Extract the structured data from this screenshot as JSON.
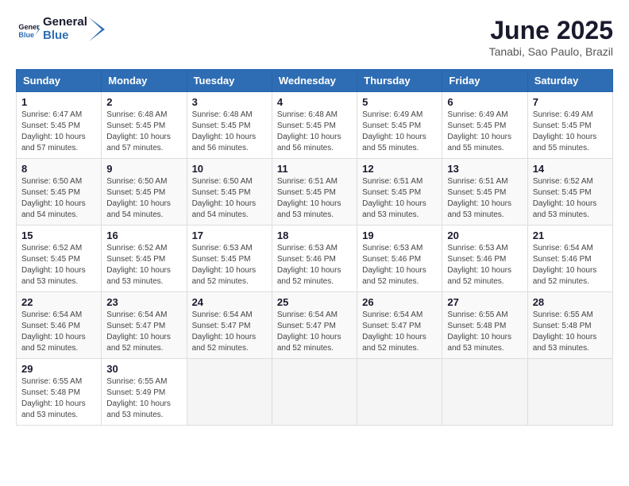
{
  "header": {
    "logo_text_general": "General",
    "logo_text_blue": "Blue",
    "month_title": "June 2025",
    "location": "Tanabi, Sao Paulo, Brazil"
  },
  "days_of_week": [
    "Sunday",
    "Monday",
    "Tuesday",
    "Wednesday",
    "Thursday",
    "Friday",
    "Saturday"
  ],
  "weeks": [
    [
      {
        "day": "1",
        "info": "Sunrise: 6:47 AM\nSunset: 5:45 PM\nDaylight: 10 hours\nand 57 minutes."
      },
      {
        "day": "2",
        "info": "Sunrise: 6:48 AM\nSunset: 5:45 PM\nDaylight: 10 hours\nand 57 minutes."
      },
      {
        "day": "3",
        "info": "Sunrise: 6:48 AM\nSunset: 5:45 PM\nDaylight: 10 hours\nand 56 minutes."
      },
      {
        "day": "4",
        "info": "Sunrise: 6:48 AM\nSunset: 5:45 PM\nDaylight: 10 hours\nand 56 minutes."
      },
      {
        "day": "5",
        "info": "Sunrise: 6:49 AM\nSunset: 5:45 PM\nDaylight: 10 hours\nand 55 minutes."
      },
      {
        "day": "6",
        "info": "Sunrise: 6:49 AM\nSunset: 5:45 PM\nDaylight: 10 hours\nand 55 minutes."
      },
      {
        "day": "7",
        "info": "Sunrise: 6:49 AM\nSunset: 5:45 PM\nDaylight: 10 hours\nand 55 minutes."
      }
    ],
    [
      {
        "day": "8",
        "info": "Sunrise: 6:50 AM\nSunset: 5:45 PM\nDaylight: 10 hours\nand 54 minutes."
      },
      {
        "day": "9",
        "info": "Sunrise: 6:50 AM\nSunset: 5:45 PM\nDaylight: 10 hours\nand 54 minutes."
      },
      {
        "day": "10",
        "info": "Sunrise: 6:50 AM\nSunset: 5:45 PM\nDaylight: 10 hours\nand 54 minutes."
      },
      {
        "day": "11",
        "info": "Sunrise: 6:51 AM\nSunset: 5:45 PM\nDaylight: 10 hours\nand 53 minutes."
      },
      {
        "day": "12",
        "info": "Sunrise: 6:51 AM\nSunset: 5:45 PM\nDaylight: 10 hours\nand 53 minutes."
      },
      {
        "day": "13",
        "info": "Sunrise: 6:51 AM\nSunset: 5:45 PM\nDaylight: 10 hours\nand 53 minutes."
      },
      {
        "day": "14",
        "info": "Sunrise: 6:52 AM\nSunset: 5:45 PM\nDaylight: 10 hours\nand 53 minutes."
      }
    ],
    [
      {
        "day": "15",
        "info": "Sunrise: 6:52 AM\nSunset: 5:45 PM\nDaylight: 10 hours\nand 53 minutes."
      },
      {
        "day": "16",
        "info": "Sunrise: 6:52 AM\nSunset: 5:45 PM\nDaylight: 10 hours\nand 53 minutes."
      },
      {
        "day": "17",
        "info": "Sunrise: 6:53 AM\nSunset: 5:45 PM\nDaylight: 10 hours\nand 52 minutes."
      },
      {
        "day": "18",
        "info": "Sunrise: 6:53 AM\nSunset: 5:46 PM\nDaylight: 10 hours\nand 52 minutes."
      },
      {
        "day": "19",
        "info": "Sunrise: 6:53 AM\nSunset: 5:46 PM\nDaylight: 10 hours\nand 52 minutes."
      },
      {
        "day": "20",
        "info": "Sunrise: 6:53 AM\nSunset: 5:46 PM\nDaylight: 10 hours\nand 52 minutes."
      },
      {
        "day": "21",
        "info": "Sunrise: 6:54 AM\nSunset: 5:46 PM\nDaylight: 10 hours\nand 52 minutes."
      }
    ],
    [
      {
        "day": "22",
        "info": "Sunrise: 6:54 AM\nSunset: 5:46 PM\nDaylight: 10 hours\nand 52 minutes."
      },
      {
        "day": "23",
        "info": "Sunrise: 6:54 AM\nSunset: 5:47 PM\nDaylight: 10 hours\nand 52 minutes."
      },
      {
        "day": "24",
        "info": "Sunrise: 6:54 AM\nSunset: 5:47 PM\nDaylight: 10 hours\nand 52 minutes."
      },
      {
        "day": "25",
        "info": "Sunrise: 6:54 AM\nSunset: 5:47 PM\nDaylight: 10 hours\nand 52 minutes."
      },
      {
        "day": "26",
        "info": "Sunrise: 6:54 AM\nSunset: 5:47 PM\nDaylight: 10 hours\nand 52 minutes."
      },
      {
        "day": "27",
        "info": "Sunrise: 6:55 AM\nSunset: 5:48 PM\nDaylight: 10 hours\nand 53 minutes."
      },
      {
        "day": "28",
        "info": "Sunrise: 6:55 AM\nSunset: 5:48 PM\nDaylight: 10 hours\nand 53 minutes."
      }
    ],
    [
      {
        "day": "29",
        "info": "Sunrise: 6:55 AM\nSunset: 5:48 PM\nDaylight: 10 hours\nand 53 minutes."
      },
      {
        "day": "30",
        "info": "Sunrise: 6:55 AM\nSunset: 5:49 PM\nDaylight: 10 hours\nand 53 minutes."
      },
      {
        "day": "",
        "info": ""
      },
      {
        "day": "",
        "info": ""
      },
      {
        "day": "",
        "info": ""
      },
      {
        "day": "",
        "info": ""
      },
      {
        "day": "",
        "info": ""
      }
    ]
  ]
}
